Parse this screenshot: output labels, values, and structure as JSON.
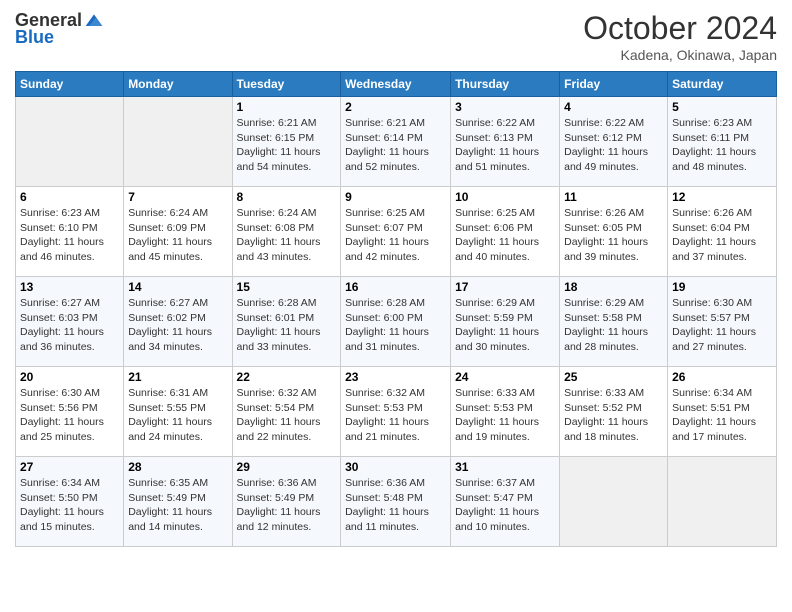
{
  "header": {
    "logo_general": "General",
    "logo_blue": "Blue",
    "month": "October 2024",
    "location": "Kadena, Okinawa, Japan"
  },
  "weekdays": [
    "Sunday",
    "Monday",
    "Tuesday",
    "Wednesday",
    "Thursday",
    "Friday",
    "Saturday"
  ],
  "weeks": [
    [
      {
        "day": "",
        "sunrise": "",
        "sunset": "",
        "daylight": "",
        "empty": true
      },
      {
        "day": "",
        "sunrise": "",
        "sunset": "",
        "daylight": "",
        "empty": true
      },
      {
        "day": "1",
        "sunrise": "Sunrise: 6:21 AM",
        "sunset": "Sunset: 6:15 PM",
        "daylight": "Daylight: 11 hours and 54 minutes."
      },
      {
        "day": "2",
        "sunrise": "Sunrise: 6:21 AM",
        "sunset": "Sunset: 6:14 PM",
        "daylight": "Daylight: 11 hours and 52 minutes."
      },
      {
        "day": "3",
        "sunrise": "Sunrise: 6:22 AM",
        "sunset": "Sunset: 6:13 PM",
        "daylight": "Daylight: 11 hours and 51 minutes."
      },
      {
        "day": "4",
        "sunrise": "Sunrise: 6:22 AM",
        "sunset": "Sunset: 6:12 PM",
        "daylight": "Daylight: 11 hours and 49 minutes."
      },
      {
        "day": "5",
        "sunrise": "Sunrise: 6:23 AM",
        "sunset": "Sunset: 6:11 PM",
        "daylight": "Daylight: 11 hours and 48 minutes."
      }
    ],
    [
      {
        "day": "6",
        "sunrise": "Sunrise: 6:23 AM",
        "sunset": "Sunset: 6:10 PM",
        "daylight": "Daylight: 11 hours and 46 minutes."
      },
      {
        "day": "7",
        "sunrise": "Sunrise: 6:24 AM",
        "sunset": "Sunset: 6:09 PM",
        "daylight": "Daylight: 11 hours and 45 minutes."
      },
      {
        "day": "8",
        "sunrise": "Sunrise: 6:24 AM",
        "sunset": "Sunset: 6:08 PM",
        "daylight": "Daylight: 11 hours and 43 minutes."
      },
      {
        "day": "9",
        "sunrise": "Sunrise: 6:25 AM",
        "sunset": "Sunset: 6:07 PM",
        "daylight": "Daylight: 11 hours and 42 minutes."
      },
      {
        "day": "10",
        "sunrise": "Sunrise: 6:25 AM",
        "sunset": "Sunset: 6:06 PM",
        "daylight": "Daylight: 11 hours and 40 minutes."
      },
      {
        "day": "11",
        "sunrise": "Sunrise: 6:26 AM",
        "sunset": "Sunset: 6:05 PM",
        "daylight": "Daylight: 11 hours and 39 minutes."
      },
      {
        "day": "12",
        "sunrise": "Sunrise: 6:26 AM",
        "sunset": "Sunset: 6:04 PM",
        "daylight": "Daylight: 11 hours and 37 minutes."
      }
    ],
    [
      {
        "day": "13",
        "sunrise": "Sunrise: 6:27 AM",
        "sunset": "Sunset: 6:03 PM",
        "daylight": "Daylight: 11 hours and 36 minutes."
      },
      {
        "day": "14",
        "sunrise": "Sunrise: 6:27 AM",
        "sunset": "Sunset: 6:02 PM",
        "daylight": "Daylight: 11 hours and 34 minutes."
      },
      {
        "day": "15",
        "sunrise": "Sunrise: 6:28 AM",
        "sunset": "Sunset: 6:01 PM",
        "daylight": "Daylight: 11 hours and 33 minutes."
      },
      {
        "day": "16",
        "sunrise": "Sunrise: 6:28 AM",
        "sunset": "Sunset: 6:00 PM",
        "daylight": "Daylight: 11 hours and 31 minutes."
      },
      {
        "day": "17",
        "sunrise": "Sunrise: 6:29 AM",
        "sunset": "Sunset: 5:59 PM",
        "daylight": "Daylight: 11 hours and 30 minutes."
      },
      {
        "day": "18",
        "sunrise": "Sunrise: 6:29 AM",
        "sunset": "Sunset: 5:58 PM",
        "daylight": "Daylight: 11 hours and 28 minutes."
      },
      {
        "day": "19",
        "sunrise": "Sunrise: 6:30 AM",
        "sunset": "Sunset: 5:57 PM",
        "daylight": "Daylight: 11 hours and 27 minutes."
      }
    ],
    [
      {
        "day": "20",
        "sunrise": "Sunrise: 6:30 AM",
        "sunset": "Sunset: 5:56 PM",
        "daylight": "Daylight: 11 hours and 25 minutes."
      },
      {
        "day": "21",
        "sunrise": "Sunrise: 6:31 AM",
        "sunset": "Sunset: 5:55 PM",
        "daylight": "Daylight: 11 hours and 24 minutes."
      },
      {
        "day": "22",
        "sunrise": "Sunrise: 6:32 AM",
        "sunset": "Sunset: 5:54 PM",
        "daylight": "Daylight: 11 hours and 22 minutes."
      },
      {
        "day": "23",
        "sunrise": "Sunrise: 6:32 AM",
        "sunset": "Sunset: 5:53 PM",
        "daylight": "Daylight: 11 hours and 21 minutes."
      },
      {
        "day": "24",
        "sunrise": "Sunrise: 6:33 AM",
        "sunset": "Sunset: 5:53 PM",
        "daylight": "Daylight: 11 hours and 19 minutes."
      },
      {
        "day": "25",
        "sunrise": "Sunrise: 6:33 AM",
        "sunset": "Sunset: 5:52 PM",
        "daylight": "Daylight: 11 hours and 18 minutes."
      },
      {
        "day": "26",
        "sunrise": "Sunrise: 6:34 AM",
        "sunset": "Sunset: 5:51 PM",
        "daylight": "Daylight: 11 hours and 17 minutes."
      }
    ],
    [
      {
        "day": "27",
        "sunrise": "Sunrise: 6:34 AM",
        "sunset": "Sunset: 5:50 PM",
        "daylight": "Daylight: 11 hours and 15 minutes."
      },
      {
        "day": "28",
        "sunrise": "Sunrise: 6:35 AM",
        "sunset": "Sunset: 5:49 PM",
        "daylight": "Daylight: 11 hours and 14 minutes."
      },
      {
        "day": "29",
        "sunrise": "Sunrise: 6:36 AM",
        "sunset": "Sunset: 5:49 PM",
        "daylight": "Daylight: 11 hours and 12 minutes."
      },
      {
        "day": "30",
        "sunrise": "Sunrise: 6:36 AM",
        "sunset": "Sunset: 5:48 PM",
        "daylight": "Daylight: 11 hours and 11 minutes."
      },
      {
        "day": "31",
        "sunrise": "Sunrise: 6:37 AM",
        "sunset": "Sunset: 5:47 PM",
        "daylight": "Daylight: 11 hours and 10 minutes."
      },
      {
        "day": "",
        "sunrise": "",
        "sunset": "",
        "daylight": "",
        "empty": true
      },
      {
        "day": "",
        "sunrise": "",
        "sunset": "",
        "daylight": "",
        "empty": true
      }
    ]
  ]
}
